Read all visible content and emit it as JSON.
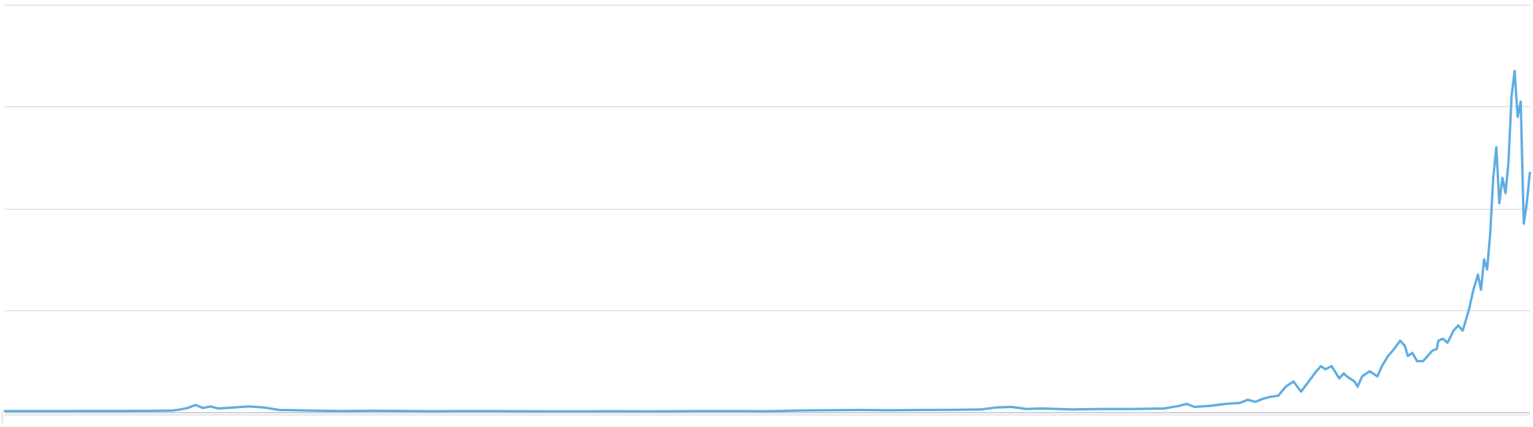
{
  "chart_data": {
    "type": "line",
    "title": "",
    "xlabel": "",
    "ylabel": "",
    "ylim": [
      0,
      4
    ],
    "xlim": [
      0,
      100
    ],
    "grid": true,
    "legend": "none",
    "colors": {
      "line": "#5dade2",
      "grid": "#d6d6d6",
      "baseline": "#c8c8c8",
      "baseline_band": "#eeeeee"
    },
    "series": [
      {
        "values": [
          [
            0,
            0.01
          ],
          [
            2,
            0.01
          ],
          [
            4,
            0.01
          ],
          [
            6,
            0.011
          ],
          [
            8,
            0.011
          ],
          [
            10,
            0.012
          ],
          [
            11,
            0.015
          ],
          [
            11.5,
            0.025
          ],
          [
            12,
            0.04
          ],
          [
            12.5,
            0.07
          ],
          [
            13,
            0.04
          ],
          [
            13.5,
            0.055
          ],
          [
            14,
            0.035
          ],
          [
            15,
            0.045
          ],
          [
            16,
            0.055
          ],
          [
            17,
            0.045
          ],
          [
            18,
            0.02
          ],
          [
            20,
            0.015
          ],
          [
            22,
            0.01
          ],
          [
            24,
            0.012
          ],
          [
            26,
            0.011
          ],
          [
            28,
            0.008
          ],
          [
            30,
            0.01
          ],
          [
            32,
            0.009
          ],
          [
            34,
            0.008
          ],
          [
            36,
            0.007
          ],
          [
            38,
            0.007
          ],
          [
            40,
            0.008
          ],
          [
            42,
            0.007
          ],
          [
            44,
            0.008
          ],
          [
            46,
            0.01
          ],
          [
            48,
            0.01
          ],
          [
            50,
            0.008
          ],
          [
            52,
            0.015
          ],
          [
            54,
            0.018
          ],
          [
            56,
            0.02
          ],
          [
            58,
            0.018
          ],
          [
            60,
            0.02
          ],
          [
            62,
            0.022
          ],
          [
            64,
            0.025
          ],
          [
            65,
            0.045
          ],
          [
            66,
            0.05
          ],
          [
            67,
            0.03
          ],
          [
            68,
            0.035
          ],
          [
            69,
            0.03
          ],
          [
            70,
            0.025
          ],
          [
            72,
            0.03
          ],
          [
            74,
            0.03
          ],
          [
            76,
            0.035
          ],
          [
            77,
            0.06
          ],
          [
            77.5,
            0.08
          ],
          [
            78,
            0.05
          ],
          [
            79,
            0.06
          ],
          [
            80,
            0.08
          ],
          [
            81,
            0.09
          ],
          [
            81.5,
            0.12
          ],
          [
            82,
            0.1
          ],
          [
            82.5,
            0.13
          ],
          [
            83,
            0.15
          ],
          [
            83.5,
            0.16
          ],
          [
            84,
            0.25
          ],
          [
            84.5,
            0.3
          ],
          [
            85,
            0.2
          ],
          [
            85.5,
            0.3
          ],
          [
            86,
            0.4
          ],
          [
            86.3,
            0.45
          ],
          [
            86.6,
            0.42
          ],
          [
            87,
            0.45
          ],
          [
            87.5,
            0.33
          ],
          [
            87.8,
            0.38
          ],
          [
            88,
            0.35
          ],
          [
            88.5,
            0.3
          ],
          [
            88.7,
            0.25
          ],
          [
            89,
            0.35
          ],
          [
            89.5,
            0.4
          ],
          [
            90,
            0.35
          ],
          [
            90.3,
            0.45
          ],
          [
            90.7,
            0.55
          ],
          [
            91,
            0.6
          ],
          [
            91.5,
            0.7
          ],
          [
            91.8,
            0.65
          ],
          [
            92,
            0.55
          ],
          [
            92.3,
            0.58
          ],
          [
            92.6,
            0.5
          ],
          [
            93,
            0.5
          ],
          [
            93.3,
            0.55
          ],
          [
            93.6,
            0.6
          ],
          [
            93.9,
            0.62
          ],
          [
            94,
            0.7
          ],
          [
            94.3,
            0.72
          ],
          [
            94.6,
            0.68
          ],
          [
            95,
            0.8
          ],
          [
            95.3,
            0.85
          ],
          [
            95.6,
            0.8
          ],
          [
            96,
            1.0
          ],
          [
            96.3,
            1.2
          ],
          [
            96.6,
            1.35
          ],
          [
            96.8,
            1.2
          ],
          [
            97,
            1.5
          ],
          [
            97.2,
            1.4
          ],
          [
            97.4,
            1.75
          ],
          [
            97.6,
            2.3
          ],
          [
            97.8,
            2.6
          ],
          [
            98,
            2.05
          ],
          [
            98.2,
            2.3
          ],
          [
            98.4,
            2.15
          ],
          [
            98.6,
            2.45
          ],
          [
            98.8,
            3.1
          ],
          [
            99,
            3.35
          ],
          [
            99.2,
            2.9
          ],
          [
            99.4,
            3.05
          ],
          [
            99.6,
            1.85
          ],
          [
            99.8,
            2.05
          ],
          [
            100,
            2.35
          ]
        ]
      }
    ]
  }
}
